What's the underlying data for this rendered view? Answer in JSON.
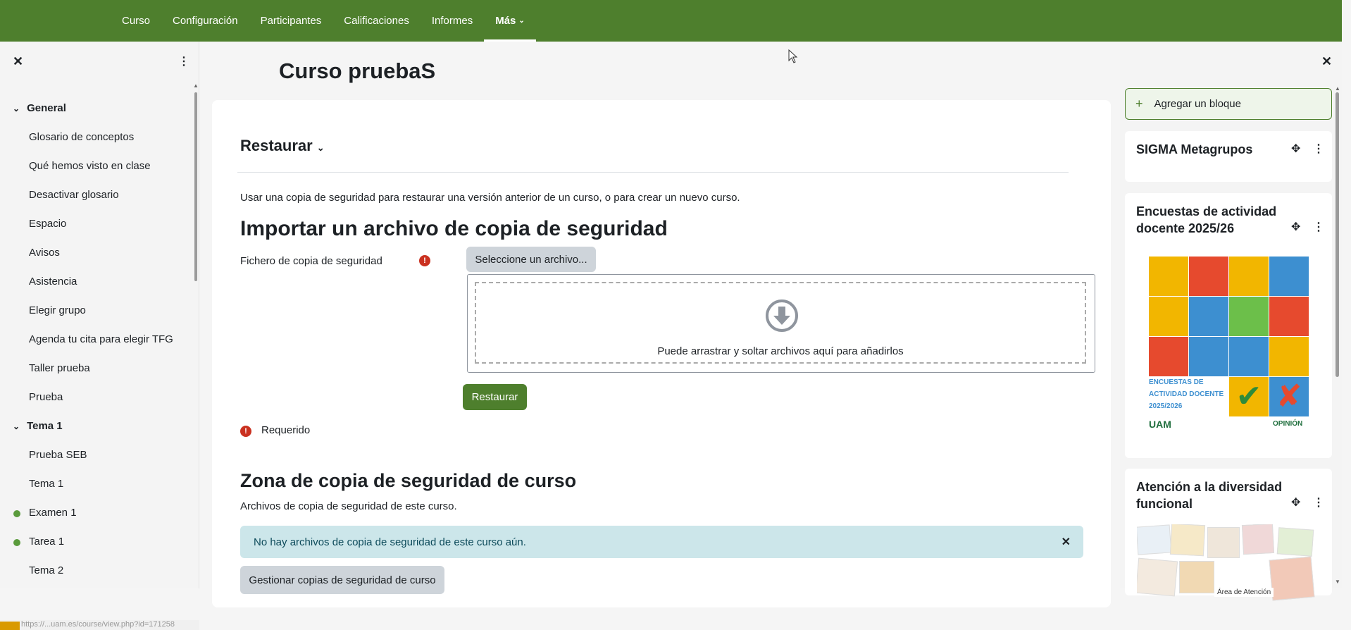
{
  "topnav": {
    "items": [
      {
        "label": "Curso"
      },
      {
        "label": "Configuración"
      },
      {
        "label": "Participantes"
      },
      {
        "label": "Calificaciones"
      },
      {
        "label": "Informes"
      },
      {
        "label": "Más",
        "active": true
      }
    ]
  },
  "course_index": {
    "sections": [
      {
        "title": "General",
        "items": [
          {
            "label": "Glosario de conceptos"
          },
          {
            "label": "Qué hemos visto en clase"
          },
          {
            "label": "Desactivar glosario"
          },
          {
            "label": "Espacio"
          },
          {
            "label": "Avisos"
          },
          {
            "label": "Asistencia"
          },
          {
            "label": "Elegir grupo"
          },
          {
            "label": "Agenda tu cita para elegir TFG"
          },
          {
            "label": "Taller prueba"
          },
          {
            "label": "Prueba"
          }
        ]
      },
      {
        "title": "Tema 1",
        "items": [
          {
            "label": "Prueba SEB"
          },
          {
            "label": "Tema 1"
          },
          {
            "label": "Examen 1",
            "completed": true
          },
          {
            "label": "Tarea 1",
            "completed": true
          },
          {
            "label": "Tema 2"
          }
        ]
      }
    ],
    "status_url": "https://...uam.es/course/view.php?id=171258"
  },
  "page": {
    "title": "Curso pruebaS",
    "restore_heading": "Restaurar",
    "intro": "Usar una copia de seguridad para restaurar una versión anterior de un curso, o para crear un nuevo curso.",
    "import_heading": "Importar un archivo de copia de seguridad",
    "file_label": "Fichero de copia de seguridad",
    "select_file_button": "Seleccione un archivo...",
    "dropzone_text": "Puede arrastrar y soltar archivos aquí para añadirlos",
    "restore_button": "Restaurar",
    "required_label": "Requerido",
    "backup_zone_heading": "Zona de copia de seguridad de curso",
    "backup_zone_subtitle": "Archivos de copia de seguridad de este curso.",
    "no_backups_alert": "No hay archivos de copia de seguridad de este curso aún.",
    "manage_backups_button": "Gestionar copias de seguridad de curso"
  },
  "blocks_drawer": {
    "add_block_label": "Agregar un bloque",
    "blocks": [
      {
        "title": "SIGMA Metagrupos"
      },
      {
        "title": "Encuestas de actividad docente 2025/26",
        "image_text": "ENCUESTAS DE ACTIVIDAD DOCENTE 2025/2026",
        "image_logo": "UAM",
        "image_logo2": "OPINIÓN"
      },
      {
        "title": "Atención a la diversidad funcional",
        "image_caption": "Área de Atención"
      }
    ]
  },
  "colors": {
    "brand": "#4e7f2d",
    "required": "#ca3120",
    "alert_bg": "#cce6ea"
  }
}
